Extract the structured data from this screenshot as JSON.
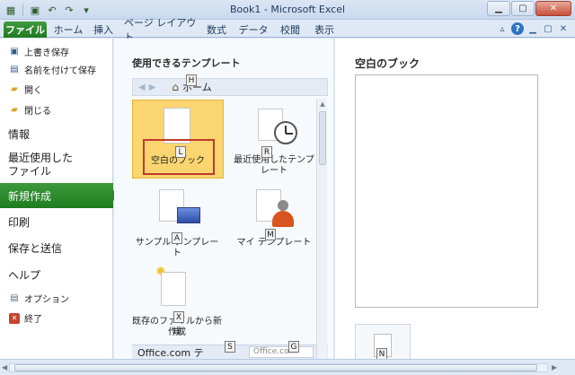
{
  "window": {
    "title": "Book1 - Microsoft Excel"
  },
  "tabs": [
    "ファイル",
    "ホーム",
    "挿入",
    "ページ レイアウト",
    "数式",
    "データ",
    "校閲",
    "表示"
  ],
  "nav": {
    "small_top": [
      {
        "label": "上書き保存",
        "icon": "save-icon"
      },
      {
        "label": "名前を付けて保存",
        "icon": "save-as-icon"
      },
      {
        "label": "開く",
        "icon": "open-folder-icon"
      },
      {
        "label": "閉じる",
        "icon": "close-folder-icon"
      }
    ],
    "info": "情報",
    "recent_line1": "最近使用した",
    "recent_line2": "ファイル",
    "new": "新規作成",
    "print": "印刷",
    "save_send": "保存と送信",
    "help": "ヘルプ",
    "options": "オプション",
    "exit": "終了"
  },
  "templates": {
    "section_title": "使用できるテンプレート",
    "breadcrumb_home": "ホーム",
    "blank": "空白のブック",
    "recent_line1": "最近使用したテンプ",
    "recent_line2": "レート",
    "sample": "サンプル テンプレート",
    "my": "マイ テンプレート",
    "existing_line1": "既存のファイルから新規",
    "existing_line2": "作成",
    "office_com": "Office.com テ",
    "search_placeholder": "Office.com"
  },
  "keytips": {
    "home": "H",
    "blank": "L",
    "recent": "R",
    "sample": "A",
    "my": "M",
    "existing": "X",
    "search": "S",
    "go": "G",
    "create": "N"
  },
  "preview": {
    "title": "空白のブック"
  },
  "colors": {
    "file_tab": "#2a8a2a",
    "selected_tile": "#fbd56f",
    "highlight_border": "#c0392b"
  }
}
